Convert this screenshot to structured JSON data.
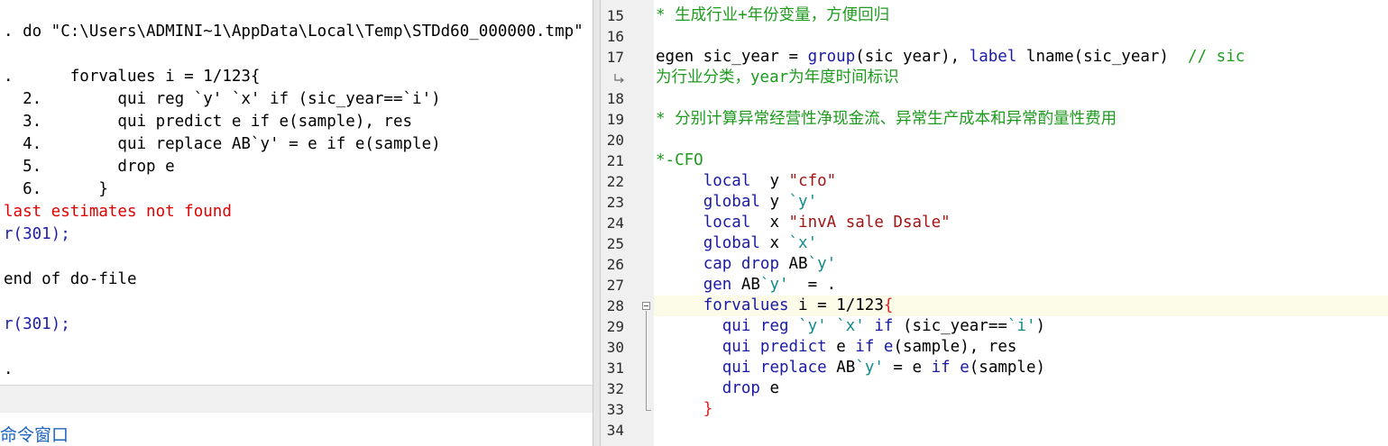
{
  "results": {
    "lines": [
      {
        "text": ". do \"C:\\Users\\ADMINI~1\\AppData\\Local\\Temp\\STDd60_000000.tmp\"",
        "kind": "normal"
      },
      {
        "text": "",
        "kind": "normal"
      },
      {
        "text": ".      forvalues i = 1/123{",
        "kind": "normal"
      },
      {
        "text": "  2.        qui reg `y' `x' if (sic_year==`i')",
        "kind": "normal"
      },
      {
        "text": "  3.        qui predict e if e(sample), res",
        "kind": "normal"
      },
      {
        "text": "  4.        qui replace AB`y' = e if e(sample)",
        "kind": "normal"
      },
      {
        "text": "  5.        drop e",
        "kind": "normal"
      },
      {
        "text": "  6.      }",
        "kind": "normal"
      },
      {
        "text": "last estimates not found",
        "kind": "err"
      },
      {
        "text": "r(301);",
        "kind": "rc"
      },
      {
        "text": "",
        "kind": "normal"
      },
      {
        "text": "end of do-file",
        "kind": "normal"
      },
      {
        "text": "",
        "kind": "normal"
      },
      {
        "text": "r(301);",
        "kind": "rc"
      },
      {
        "text": "",
        "kind": "normal"
      },
      {
        "text": ".",
        "kind": "normal"
      }
    ]
  },
  "command_window": {
    "label": "命令窗口"
  },
  "editor": {
    "line_numbers": [
      "15",
      "16",
      "17",
      "",
      "18",
      "19",
      "20",
      "21",
      "22",
      "23",
      "24",
      "25",
      "26",
      "27",
      "28",
      "29",
      "30",
      "31",
      "32",
      "33",
      "34"
    ],
    "code_lines": [
      [
        {
          "t": "* 生成行业+年份变量，方便回归",
          "c": "cmt"
        }
      ],
      [],
      [
        {
          "t": "egen sic_year = ",
          "c": ""
        },
        {
          "t": "group",
          "c": "kw"
        },
        {
          "t": "(sic year), ",
          "c": ""
        },
        {
          "t": "label",
          "c": "kw"
        },
        {
          "t": " lname(sic_year)  ",
          "c": ""
        },
        {
          "t": "// sic",
          "c": "cmt"
        }
      ],
      [
        {
          "t": "为行业分类，year为年度时间标识",
          "c": "cmt"
        }
      ],
      [],
      [
        {
          "t": "* 分别计算异常经营性净现金流、异常生产成本和异常酌量性费用",
          "c": "cmt"
        }
      ],
      [],
      [
        {
          "t": "*-CFO",
          "c": "cmt"
        }
      ],
      [
        {
          "t": "     ",
          "c": ""
        },
        {
          "t": "local",
          "c": "kw"
        },
        {
          "t": "  y ",
          "c": ""
        },
        {
          "t": "\"cfo\"",
          "c": "str"
        }
      ],
      [
        {
          "t": "     ",
          "c": ""
        },
        {
          "t": "global",
          "c": "kw"
        },
        {
          "t": " y ",
          "c": ""
        },
        {
          "t": "`y'",
          "c": "mac"
        }
      ],
      [
        {
          "t": "     ",
          "c": ""
        },
        {
          "t": "local",
          "c": "kw"
        },
        {
          "t": "  x ",
          "c": ""
        },
        {
          "t": "\"invA sale Dsale\"",
          "c": "str"
        }
      ],
      [
        {
          "t": "     ",
          "c": ""
        },
        {
          "t": "global",
          "c": "kw"
        },
        {
          "t": " x ",
          "c": ""
        },
        {
          "t": "`x'",
          "c": "mac"
        }
      ],
      [
        {
          "t": "     ",
          "c": ""
        },
        {
          "t": "cap drop",
          "c": "kw"
        },
        {
          "t": " AB",
          "c": ""
        },
        {
          "t": "`y'",
          "c": "mac"
        }
      ],
      [
        {
          "t": "     ",
          "c": ""
        },
        {
          "t": "gen",
          "c": "kw"
        },
        {
          "t": " AB",
          "c": ""
        },
        {
          "t": "`y'",
          "c": "mac"
        },
        {
          "t": "  = .",
          "c": ""
        }
      ],
      [
        {
          "t": "     ",
          "c": ""
        },
        {
          "t": "forvalues",
          "c": "kw"
        },
        {
          "t": " i = 1/123",
          "c": ""
        },
        {
          "t": "{",
          "c": "brk"
        }
      ],
      [
        {
          "t": "       ",
          "c": ""
        },
        {
          "t": "qui reg",
          "c": "kw"
        },
        {
          "t": " ",
          "c": ""
        },
        {
          "t": "`y'",
          "c": "mac"
        },
        {
          "t": " ",
          "c": ""
        },
        {
          "t": "`x'",
          "c": "mac"
        },
        {
          "t": " ",
          "c": ""
        },
        {
          "t": "if",
          "c": "kw"
        },
        {
          "t": " (sic_year==",
          "c": ""
        },
        {
          "t": "`i'",
          "c": "mac"
        },
        {
          "t": ")",
          "c": ""
        }
      ],
      [
        {
          "t": "       ",
          "c": ""
        },
        {
          "t": "qui predict",
          "c": "kw"
        },
        {
          "t": " e ",
          "c": ""
        },
        {
          "t": "if",
          "c": "kw"
        },
        {
          "t": " ",
          "c": ""
        },
        {
          "t": "e",
          "c": "kw"
        },
        {
          "t": "(sample), res",
          "c": ""
        }
      ],
      [
        {
          "t": "       ",
          "c": ""
        },
        {
          "t": "qui replace",
          "c": "kw"
        },
        {
          "t": " AB",
          "c": ""
        },
        {
          "t": "`y'",
          "c": "mac"
        },
        {
          "t": " = e ",
          "c": ""
        },
        {
          "t": "if",
          "c": "kw"
        },
        {
          "t": " ",
          "c": ""
        },
        {
          "t": "e",
          "c": "kw"
        },
        {
          "t": "(sample)",
          "c": ""
        }
      ],
      [
        {
          "t": "       ",
          "c": ""
        },
        {
          "t": "drop",
          "c": "kw"
        },
        {
          "t": " e",
          "c": ""
        }
      ],
      [
        {
          "t": "     ",
          "c": ""
        },
        {
          "t": "}",
          "c": "brk"
        }
      ],
      []
    ]
  },
  "colors": {
    "comment": "#1f9a1f",
    "keyword": "#1a1aa6",
    "string": "#a31515",
    "macro": "#138a8a",
    "bracket": "#e02020",
    "error": "#e00000",
    "return_code": "#1f1fa8"
  },
  "icons": {
    "wrap": "wrap-arrow-icon",
    "fold": "fold-minus-icon"
  }
}
